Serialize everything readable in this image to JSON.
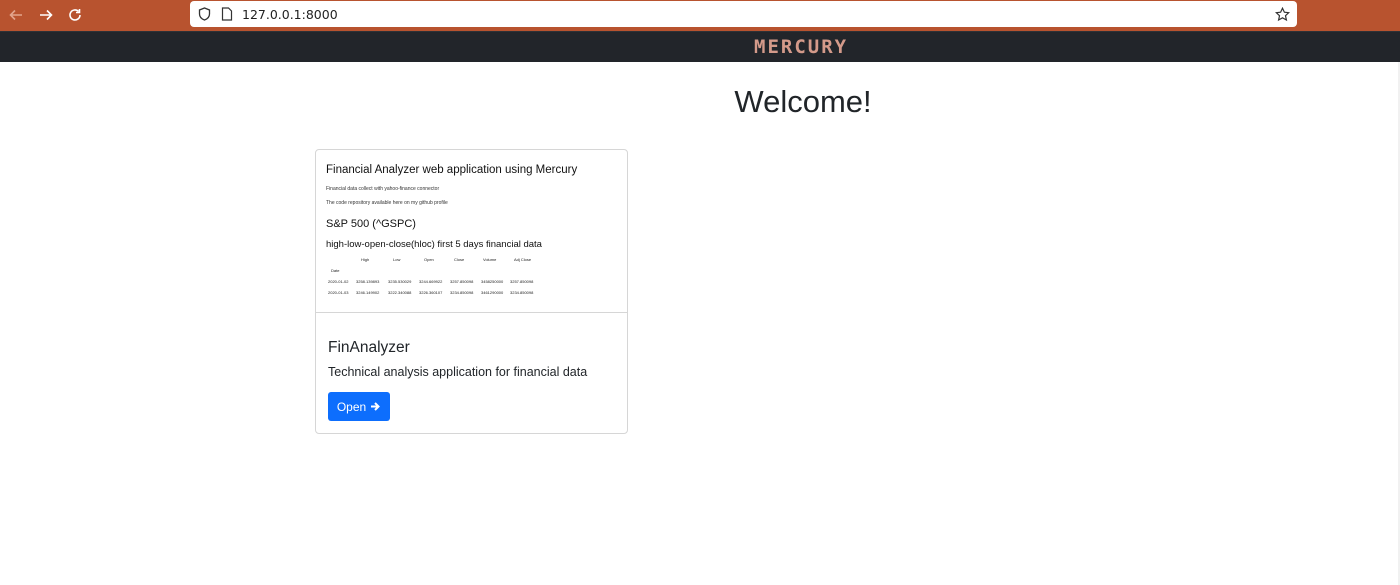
{
  "browser": {
    "url": "127.0.0.1:8000",
    "back_icon": "arrow-left-icon",
    "forward_icon": "arrow-right-icon",
    "reload_icon": "reload-icon",
    "bookmark_icon": "star-icon",
    "accent": "#b8532f"
  },
  "navbar": {
    "brand": "MERCURY",
    "background": "#22252a"
  },
  "page": {
    "title": "Welcome!"
  },
  "card": {
    "preview": {
      "title": "Financial Analyzer web application using Mercury",
      "line1": "Financial data collect with yahoo-finance connector",
      "line2": "The code repository available here on my github profile",
      "heading": "S&P 500 (^GSPC)",
      "subheading": "high-low-open-close(hloc) first 5 days financial data",
      "table": {
        "columns": [
          "High",
          "Low",
          "Open",
          "Close",
          "Volume",
          "Adj Close"
        ],
        "index_label": "Date",
        "rows": [
          [
            "2020-01-02",
            "3258.139893",
            "3235.530029",
            "3244.669922",
            "3257.850098",
            "3458250000",
            "3257.850098"
          ],
          [
            "2020-01-03",
            "3246.149902",
            "3222.340088",
            "3226.360107",
            "3234.850098",
            "3461290000",
            "3234.850098"
          ]
        ]
      }
    },
    "title": "FinAnalyzer",
    "description": "Technical analysis application for financial data",
    "button_label": "Open",
    "button_color": "#0d6efd"
  }
}
